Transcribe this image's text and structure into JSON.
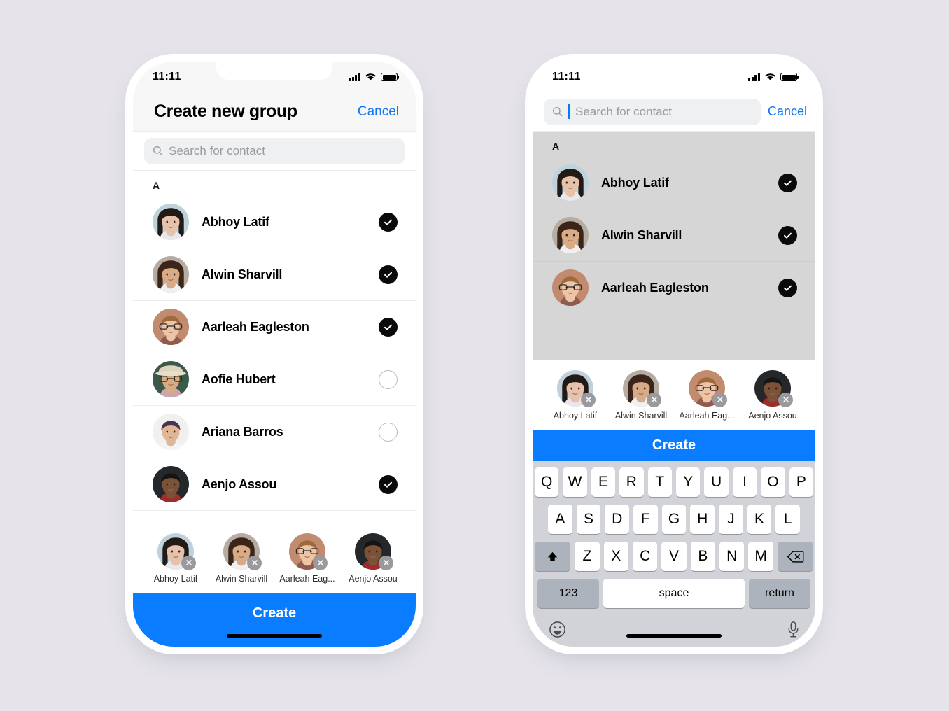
{
  "background_color": "#e6e4ea",
  "accent_color": "#0a7cff",
  "link_color": "#1276f0",
  "status_bar": {
    "time": "11:11",
    "icons": [
      "signal-bars-icon",
      "wifi-icon",
      "battery-icon"
    ]
  },
  "left_phone": {
    "header": {
      "title": "Create new group",
      "cancel_label": "Cancel"
    },
    "search": {
      "placeholder": "Search for contact",
      "value": "",
      "icon": "search-icon"
    },
    "section_header": "A",
    "contacts": [
      {
        "name": "Abhoy Latif",
        "selected": true
      },
      {
        "name": "Alwin Sharvill",
        "selected": true
      },
      {
        "name": "Aarleah Eagleston",
        "selected": true
      },
      {
        "name": "Aofie Hubert",
        "selected": false
      },
      {
        "name": "Ariana Barros",
        "selected": false
      },
      {
        "name": "Aenjo Assou",
        "selected": true
      }
    ],
    "selected_tray": [
      {
        "label": "Abhoy Latif"
      },
      {
        "label": "Alwin Sharvill"
      },
      {
        "label": "Aarleah Eag..."
      },
      {
        "label": "Aenjo Assou"
      }
    ],
    "create_label": "Create"
  },
  "right_phone": {
    "search": {
      "placeholder": "Search for contact",
      "value": "",
      "cancel_label": "Cancel",
      "icon": "search-icon",
      "focused": true
    },
    "section_header": "A",
    "contacts": [
      {
        "name": "Abhoy Latif",
        "selected": true
      },
      {
        "name": "Alwin Sharvill",
        "selected": true
      },
      {
        "name": "Aarleah Eagleston",
        "selected": true
      }
    ],
    "selected_tray": [
      {
        "label": "Abhoy Latif"
      },
      {
        "label": "Alwin Sharvill"
      },
      {
        "label": "Aarleah Eag..."
      },
      {
        "label": "Aenjo Assou"
      }
    ],
    "create_label": "Create",
    "keyboard": {
      "row1": [
        "Q",
        "W",
        "E",
        "R",
        "T",
        "Y",
        "U",
        "I",
        "O",
        "P"
      ],
      "row2": [
        "A",
        "S",
        "D",
        "F",
        "G",
        "H",
        "J",
        "K",
        "L"
      ],
      "row3": [
        "Z",
        "X",
        "C",
        "V",
        "B",
        "N",
        "M"
      ],
      "shift_icon": "shift-arrow-icon",
      "delete_icon": "backspace-icon",
      "numbers_label": "123",
      "space_label": "space",
      "return_label": "return",
      "emoji_icon": "emoji-smiley-icon",
      "mic_icon": "microphone-icon"
    }
  }
}
